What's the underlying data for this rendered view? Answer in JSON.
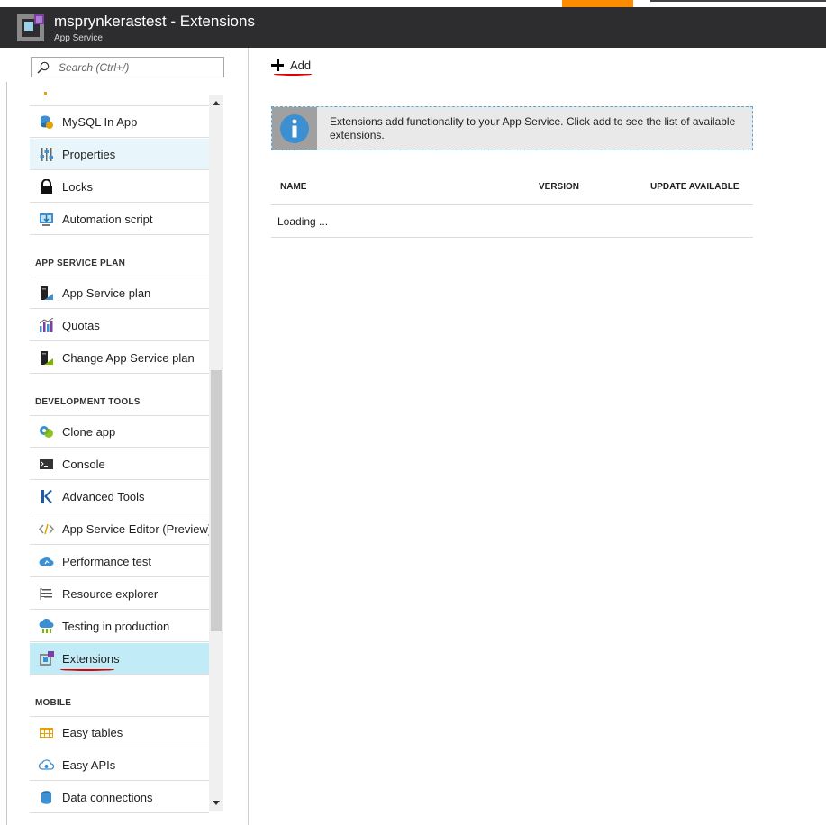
{
  "window": {
    "title": "msprynkerastest - Extensions",
    "subtitle": "App Service"
  },
  "search": {
    "placeholder": "Search (Ctrl+/)",
    "value": ""
  },
  "sidebar": {
    "items_top": [
      {
        "label": "MySQL In App",
        "icon": "mysql-icon"
      },
      {
        "label": "Properties",
        "icon": "properties-sliders-icon"
      },
      {
        "label": "Locks",
        "icon": "lock-icon"
      },
      {
        "label": "Automation script",
        "icon": "automation-script-icon"
      }
    ],
    "sections": [
      {
        "title": "APP SERVICE PLAN",
        "items": [
          {
            "label": "App Service plan",
            "icon": "app-service-plan-icon"
          },
          {
            "label": "Quotas",
            "icon": "quotas-chart-icon"
          },
          {
            "label": "Change App Service plan",
            "icon": "change-plan-icon"
          }
        ]
      },
      {
        "title": "DEVELOPMENT TOOLS",
        "items": [
          {
            "label": "Clone app",
            "icon": "clone-app-icon"
          },
          {
            "label": "Console",
            "icon": "console-icon"
          },
          {
            "label": "Advanced Tools",
            "icon": "kudu-icon"
          },
          {
            "label": "App Service Editor (Preview)",
            "icon": "code-editor-icon"
          },
          {
            "label": "Performance test",
            "icon": "cloud-performance-icon"
          },
          {
            "label": "Resource explorer",
            "icon": "resource-explorer-icon"
          },
          {
            "label": "Testing in production",
            "icon": "testing-production-icon"
          },
          {
            "label": "Extensions",
            "icon": "extensions-icon",
            "selected": true
          }
        ]
      },
      {
        "title": "MOBILE",
        "items": [
          {
            "label": "Easy tables",
            "icon": "table-icon"
          },
          {
            "label": "Easy APIs",
            "icon": "cloud-api-icon"
          },
          {
            "label": "Data connections",
            "icon": "database-icon"
          }
        ]
      }
    ]
  },
  "toolbar": {
    "add_label": "Add"
  },
  "info": {
    "text": "Extensions add functionality to your App Service. Click add to see the list of available extensions."
  },
  "table": {
    "columns": [
      "NAME",
      "VERSION",
      "UPDATE AVAILABLE"
    ],
    "loading_text": "Loading ..."
  },
  "colors": {
    "header_bg": "#2d2d30",
    "accent_orange": "#ff8c00",
    "selected_item_bg": "#c2ebf8",
    "hover_item_bg": "#e8f6fb",
    "info_border": "#58a6d6",
    "annotation_red": "#e00000"
  }
}
